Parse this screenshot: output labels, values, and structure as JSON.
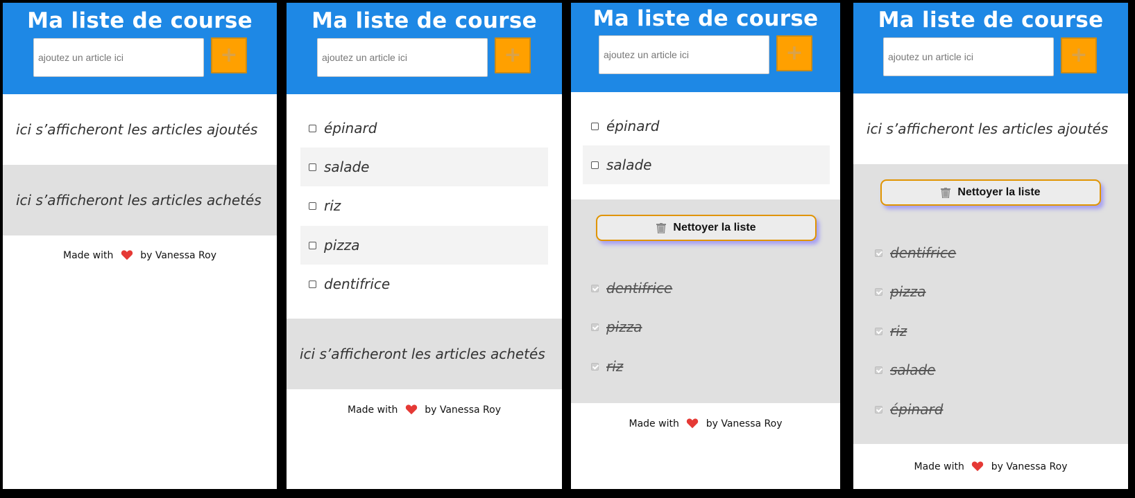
{
  "app": {
    "title": "Ma liste de course",
    "input_placeholder": "ajoutez un article ici",
    "add_label": "+",
    "added_placeholder": "ici s’afficheront les articles ajoutés",
    "bought_placeholder": "ici s’afficheront les articles achetés",
    "clean_label": "Nettoyer la liste",
    "footer_before": "Made with",
    "footer_after": "by Vanessa Roy"
  },
  "panels": [
    {
      "added_items": [],
      "bought_items": []
    },
    {
      "added_items": [
        "épinard",
        "salade",
        "riz",
        "pizza",
        "dentifrice"
      ],
      "bought_items": []
    },
    {
      "added_items": [
        "épinard",
        "salade"
      ],
      "bought_items": [
        "dentifrice",
        "pizza",
        "riz"
      ]
    },
    {
      "added_items": [],
      "bought_items": [
        "dentifrice",
        "pizza",
        "riz",
        "salade",
        "épinard"
      ]
    }
  ],
  "colors": {
    "header": "#1e88e5",
    "add_button": "#ffa000",
    "bought_zone": "#e0e0e0",
    "heart": "#e53935"
  },
  "icons": {
    "add": "plus-icon",
    "clean": "trash-icon",
    "footer": "heart-icon"
  }
}
